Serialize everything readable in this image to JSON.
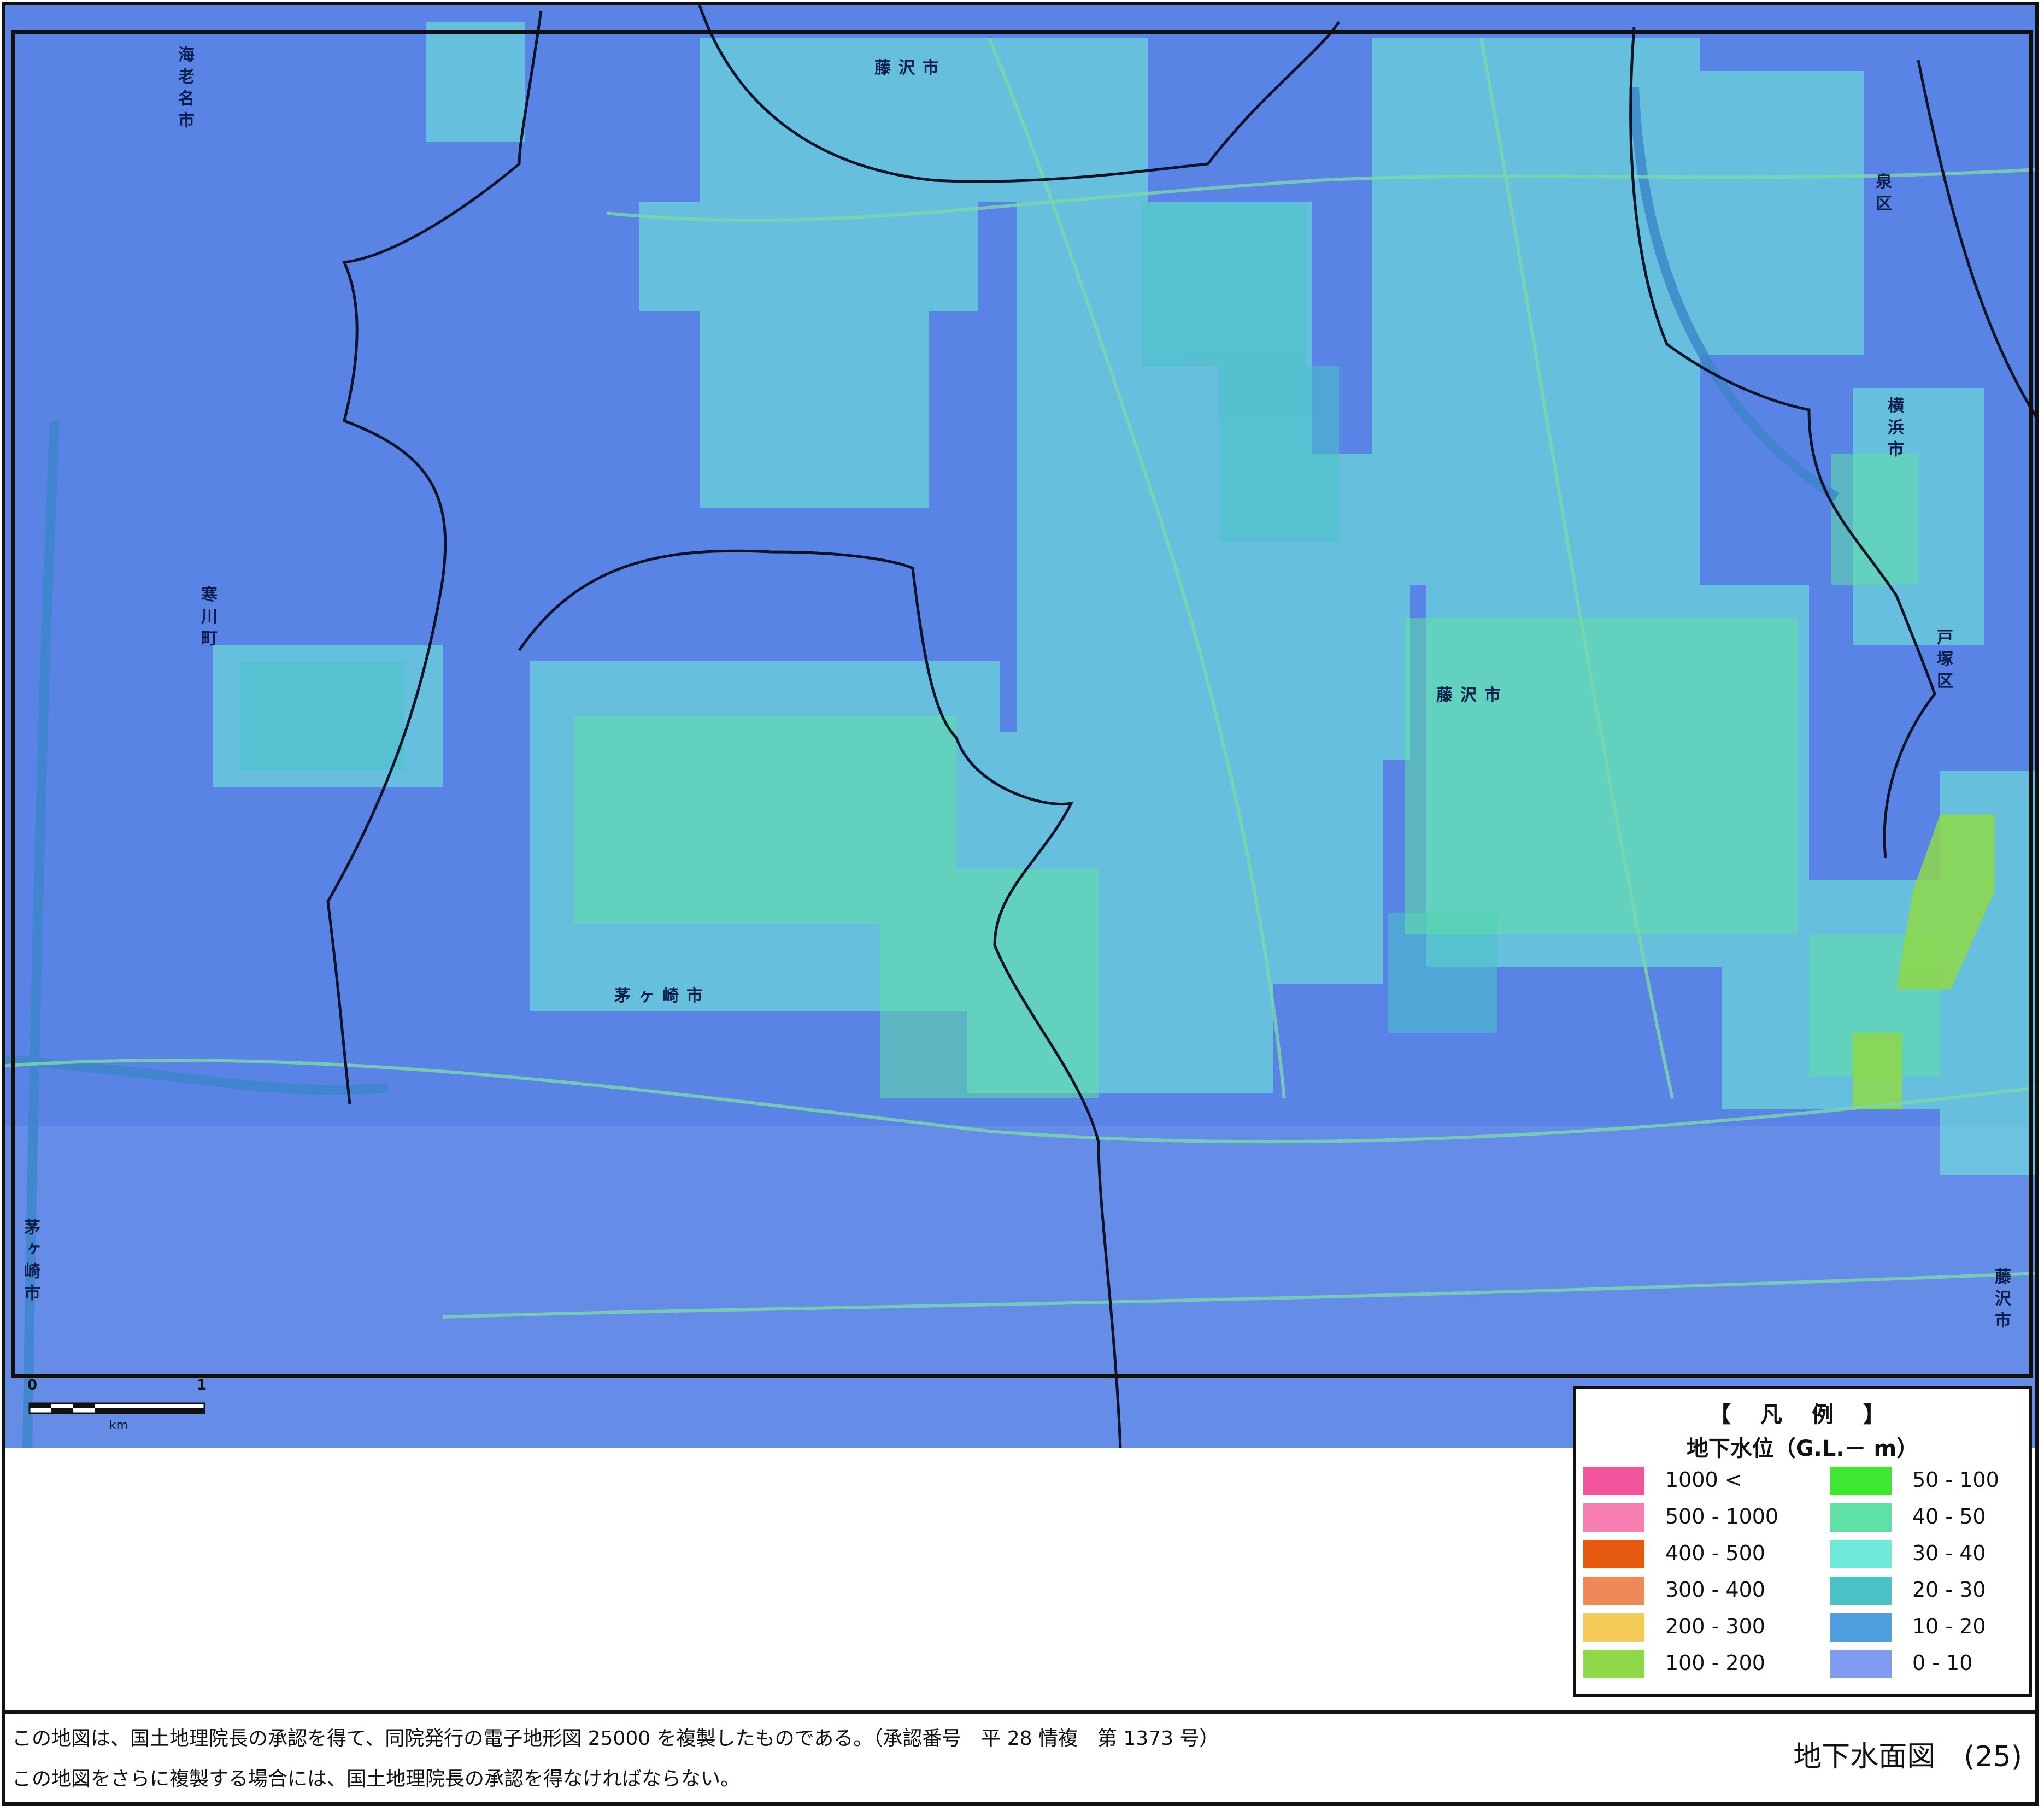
{
  "map": {
    "place_labels": [
      {
        "id": "ebina",
        "text": "海老名市"
      },
      {
        "id": "fujisawa-north",
        "text": "藤沢市"
      },
      {
        "id": "izumi",
        "text": "泉区"
      },
      {
        "id": "yokohama",
        "text": "横浜市"
      },
      {
        "id": "samukawa",
        "text": "寒川町"
      },
      {
        "id": "fujisawa-center",
        "text": "藤沢市"
      },
      {
        "id": "totsuka",
        "text": "戸塚区"
      },
      {
        "id": "chigasaki-center",
        "text": "茅ヶ崎市"
      },
      {
        "id": "chigasaki-west",
        "text": "茅ヶ崎市"
      },
      {
        "id": "fujisawa-east",
        "text": "藤沢市"
      }
    ],
    "colors": {
      "base": "#5a83e6",
      "class_0_10": "#7f9cf0",
      "class_10_20": "#4f9fe0",
      "class_20_30": "#49c2c6",
      "class_30_40": "#6fe8d8",
      "class_40_50": "#5fe0a4",
      "class_50_100": "#3ee830",
      "class_100_200": "#8ed84a"
    }
  },
  "scale": {
    "tick_0": "0",
    "tick_1": "1",
    "unit": "km"
  },
  "legend": {
    "title": "【 凡 例 】",
    "subtitle": "地下水位（G.L.－ m）",
    "items": [
      {
        "label": "1000 <",
        "color": "#f2559c"
      },
      {
        "label": "500 - 1000",
        "color": "#f67eb0"
      },
      {
        "label": "400 - 500",
        "color": "#e55a10"
      },
      {
        "label": "300 - 400",
        "color": "#ef8a58"
      },
      {
        "label": "200 - 300",
        "color": "#f4cb57"
      },
      {
        "label": "100 - 200",
        "color": "#8ed84a"
      },
      {
        "label": "50 - 100",
        "color": "#3ee830"
      },
      {
        "label": "40 - 50",
        "color": "#5fe0a4"
      },
      {
        "label": "30 - 40",
        "color": "#6fe8d8"
      },
      {
        "label": "20 - 30",
        "color": "#49c2c6"
      },
      {
        "label": "10 - 20",
        "color": "#4f9fe0"
      },
      {
        "label": "0 - 10",
        "color": "#7f9cf0"
      }
    ]
  },
  "footer": {
    "note_1": "この地図は、国土地理院長の承認を得て、同院発行の電子地形図 25000 を複製したものである。（承認番号　平 28 情複　第 1373 号）",
    "note_2": "この地図をさらに複製する場合には、国土地理院長の承認を得なければならない。",
    "sheet_title": "地下水面図　(25)"
  }
}
